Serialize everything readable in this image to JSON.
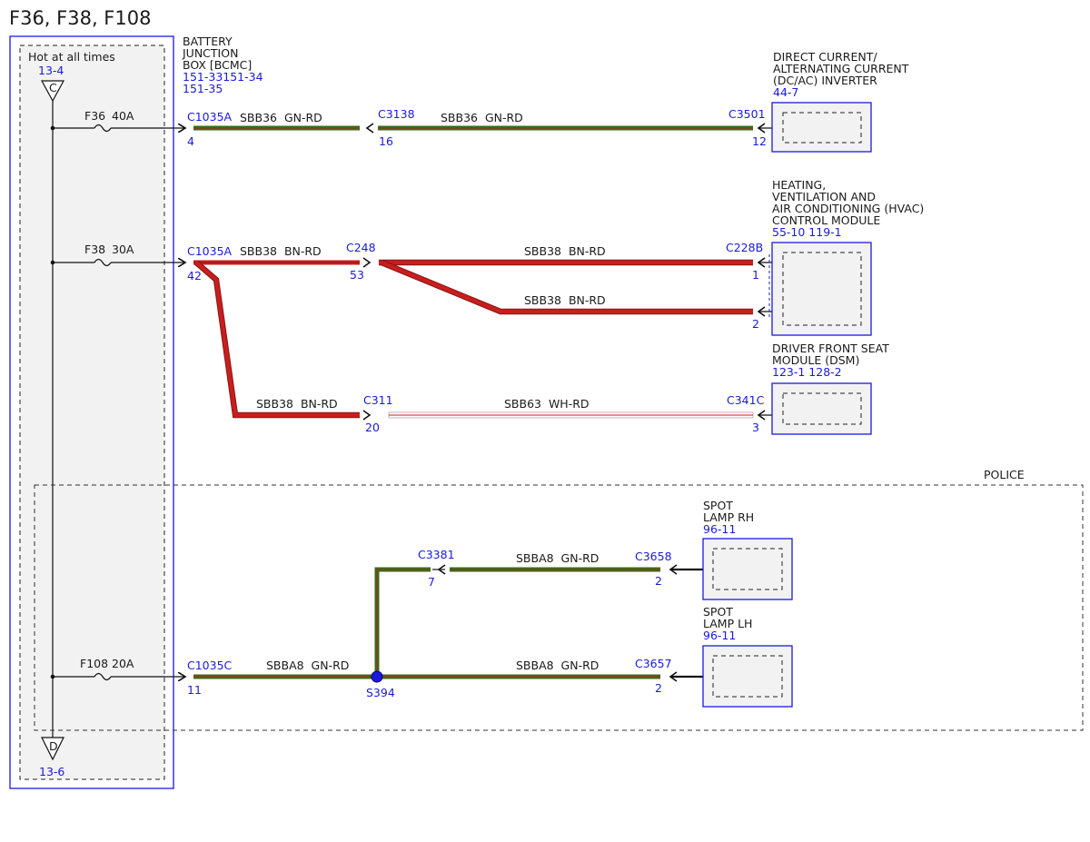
{
  "title": "F36, F38, F108",
  "hot_label": "Hot at all times",
  "top_ref": {
    "label": "C",
    "page": "13-4"
  },
  "bottom_ref": {
    "label": "D",
    "page": "13-6"
  },
  "bjb": {
    "lines": [
      "BATTERY",
      "JUNCTION",
      "BOX [BCMC]"
    ],
    "refs": [
      "151-33151-34",
      "151-35"
    ]
  },
  "fuses": [
    {
      "name": "F36",
      "rating": "40A"
    },
    {
      "name": "F38",
      "rating": "30A"
    },
    {
      "name": "F108",
      "rating": "20A"
    }
  ],
  "connectors": {
    "c1035a_1": {
      "name": "C1035A",
      "pin": "4"
    },
    "c3138": {
      "name": "C3138",
      "pin": "16"
    },
    "c3501": {
      "name": "C3501",
      "pin": "12"
    },
    "c1035a_2": {
      "name": "C1035A",
      "pin": "42"
    },
    "c248": {
      "name": "C248",
      "pin": "53"
    },
    "c228b": {
      "name": "C228B",
      "pin1": "1",
      "pin2": "2"
    },
    "c311": {
      "name": "C311",
      "pin": "20"
    },
    "c341c": {
      "name": "C341C",
      "pin": "3"
    },
    "c1035c": {
      "name": "C1035C",
      "pin": "11"
    },
    "c3381": {
      "name": "C3381",
      "pin": "7"
    },
    "c3658": {
      "name": "C3658",
      "pin": "2"
    },
    "c3657": {
      "name": "C3657",
      "pin": "2"
    },
    "s394": {
      "name": "S394"
    }
  },
  "wires": {
    "w1a": "SBB36  GN-RD",
    "w1b": "SBB36  GN-RD",
    "w2a": "SBB38  BN-RD",
    "w2b": "SBB38  BN-RD",
    "w2c": "SBB38  BN-RD",
    "w3a": "SBB38  BN-RD",
    "w3b": "SBB63  WH-RD",
    "w4a": "SBBA8  GN-RD",
    "w4b": "SBBA8  GN-RD",
    "w4c": "SBBA8  GN-RD"
  },
  "components": {
    "inverter": {
      "lines": [
        "DIRECT CURRENT/",
        "ALTERNATING CURRENT",
        "(DC/AC) INVERTER"
      ],
      "ref": "44-7"
    },
    "hvac": {
      "lines": [
        "HEATING,",
        "VENTILATION AND",
        "AIR CONDITIONING (HVAC)",
        "CONTROL MODULE"
      ],
      "ref": "55-10 119-1"
    },
    "dsm": {
      "lines": [
        "DRIVER FRONT SEAT",
        "MODULE (DSM)"
      ],
      "ref": "123-1 128-2"
    },
    "spot_rh": {
      "lines": [
        "SPOT",
        "LAMP RH"
      ],
      "ref": "96-11"
    },
    "spot_lh": {
      "lines": [
        "SPOT",
        "LAMP LH"
      ],
      "ref": "96-11"
    }
  },
  "police_label": "POLICE",
  "colors": {
    "blue": "#1a1adc",
    "green": "#3a6b1a",
    "red": "#c81e1e",
    "box_fill": "#f2f2f2"
  }
}
